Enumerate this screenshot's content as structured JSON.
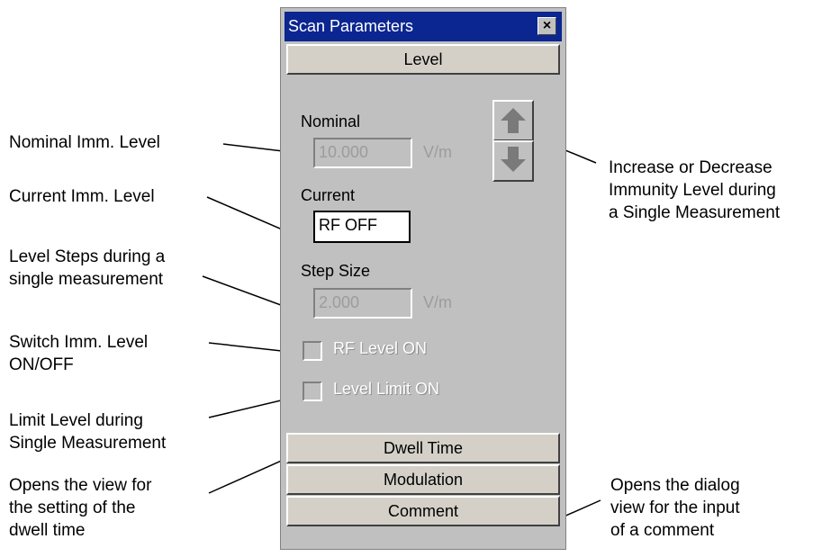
{
  "window": {
    "title": "Scan Parameters",
    "close_glyph": "×"
  },
  "buttons": {
    "level": "Level",
    "dwell_time": "Dwell Time",
    "modulation": "Modulation",
    "comment": "Comment"
  },
  "nominal": {
    "label": "Nominal",
    "value": "10.000",
    "unit": "V/m"
  },
  "current": {
    "label": "Current",
    "value": "RF OFF"
  },
  "step_size": {
    "label": "Step Size",
    "value": "2.000",
    "unit": "V/m"
  },
  "checkboxes": {
    "rf_level_on": {
      "label": "RF Level ON",
      "checked": false
    },
    "level_limit_on": {
      "label": "Level Limit ON",
      "checked": false
    }
  },
  "icons": {
    "up": "arrow-up-icon",
    "down": "arrow-down-icon",
    "close": "close-icon"
  },
  "annotations": {
    "nominal": "Nominal Imm. Level",
    "current": "Current Imm. Level",
    "steps": [
      "Level Steps during a",
      "single measurement"
    ],
    "switch": [
      "Switch Imm. Level",
      "ON/OFF"
    ],
    "limit": [
      "Limit Level during",
      "Single Measurement"
    ],
    "dwell": [
      "Opens the view for",
      "the setting of the",
      "dwell time"
    ],
    "arrows": [
      "Increase or Decrease",
      "Immunity Level during",
      "a Single Measurement"
    ],
    "comment": [
      "Opens the dialog",
      "view for the input",
      "of a comment"
    ]
  },
  "colors": {
    "titlebar": "#0b2690",
    "panel": "#c0c0c0",
    "arrow": "#7a7a7a"
  }
}
